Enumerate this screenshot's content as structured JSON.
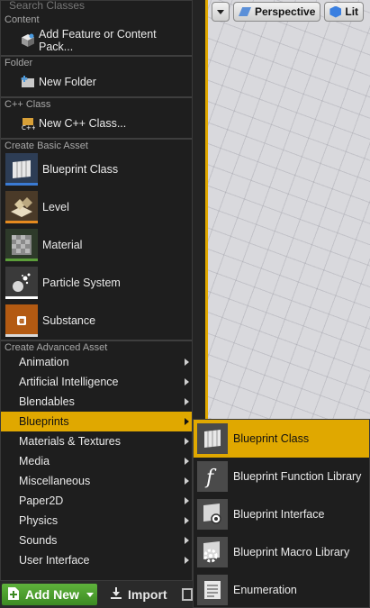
{
  "search": {
    "placeholder": "Search Classes"
  },
  "sections": {
    "content": "Content",
    "folder": "Folder",
    "cpp": "C++ Class",
    "basic": "Create Basic Asset",
    "advanced": "Create Advanced Asset"
  },
  "items": {
    "add_feature": "Add Feature or Content Pack...",
    "new_folder": "New Folder",
    "new_cpp": "New C++ Class..."
  },
  "basic_assets": [
    {
      "label": "Blueprint Class",
      "icon": "blueprint-class-icon",
      "bar": "#3a7bd5"
    },
    {
      "label": "Level",
      "icon": "level-icon",
      "bar": "#e58a1f"
    },
    {
      "label": "Material",
      "icon": "material-icon",
      "bar": "#5c9e3a"
    },
    {
      "label": "Particle System",
      "icon": "particle-system-icon",
      "bar": "#ffffff"
    },
    {
      "label": "Substance",
      "icon": "substance-icon",
      "bar": "#d9d9d9"
    }
  ],
  "advanced_assets": [
    "Animation",
    "Artificial Intelligence",
    "Blendables",
    "Blueprints",
    "Materials & Textures",
    "Media",
    "Miscellaneous",
    "Paper2D",
    "Physics",
    "Sounds",
    "User Interface"
  ],
  "active_advanced": "Blueprints",
  "toolbar": {
    "add_new": "Add New",
    "import": "Import"
  },
  "viewport": {
    "perspective": "Perspective",
    "lit": "Lit"
  },
  "submenu": [
    {
      "label": "Blueprint Class",
      "icon": "blueprint-class-icon"
    },
    {
      "label": "Blueprint Function Library",
      "icon": "function-library-icon"
    },
    {
      "label": "Blueprint Interface",
      "icon": "blueprint-interface-icon"
    },
    {
      "label": "Blueprint Macro Library",
      "icon": "macro-library-icon"
    },
    {
      "label": "Enumeration",
      "icon": "enumeration-icon"
    }
  ],
  "active_submenu": "Blueprint Class",
  "colors": {
    "accent": "#e0a800",
    "add_new_green": "#4a9c2c"
  }
}
